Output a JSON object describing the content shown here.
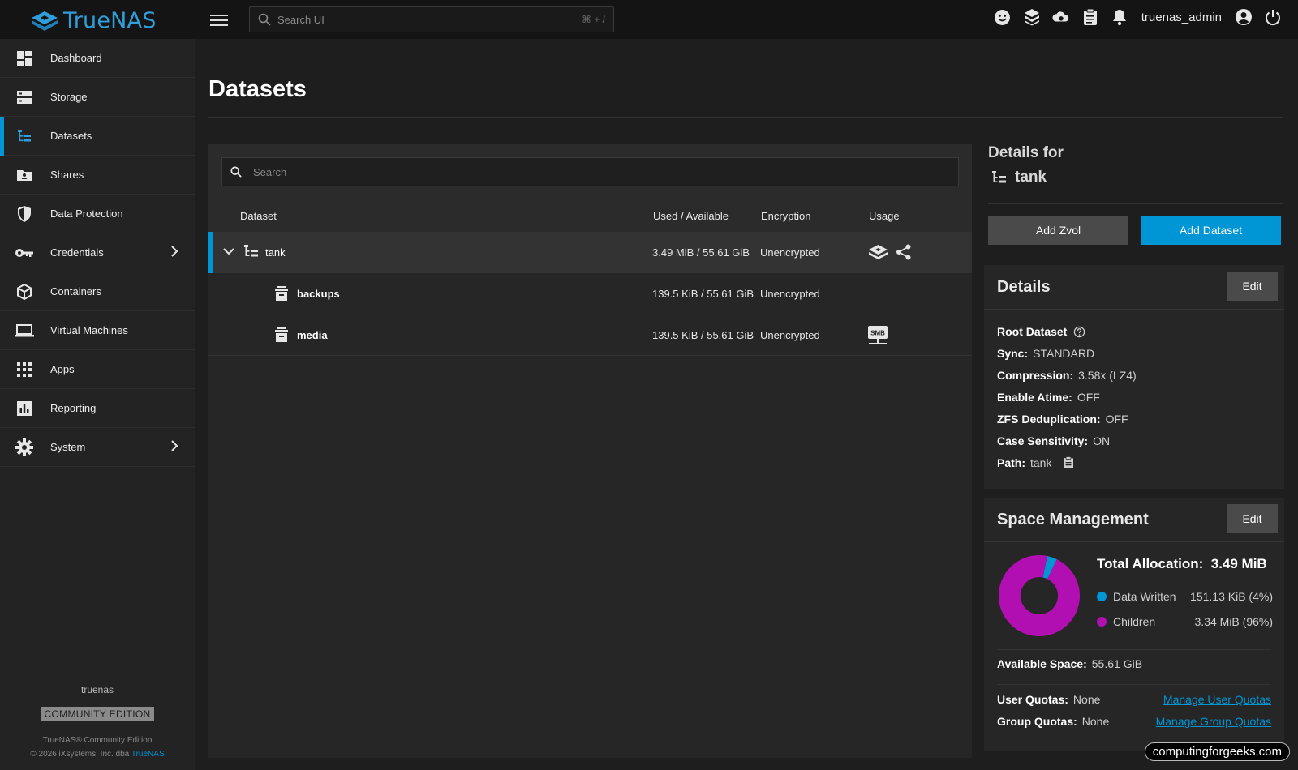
{
  "app": {
    "brand": "TrueNAS",
    "accent": "#0095d5"
  },
  "topbar": {
    "search_placeholder": "Search UI",
    "search_shortcut": "⌘ + /",
    "username": "truenas_admin",
    "icons": [
      "feedback-icon",
      "truecommand-icon",
      "jobs-icon",
      "clipboard-icon",
      "bell-icon",
      "account-icon",
      "power-icon"
    ]
  },
  "sidebar": {
    "items": [
      {
        "label": "Dashboard",
        "icon": "dashboard-icon"
      },
      {
        "label": "Storage",
        "icon": "storage-icon"
      },
      {
        "label": "Datasets",
        "icon": "datasets-icon",
        "active": true
      },
      {
        "label": "Shares",
        "icon": "shares-icon"
      },
      {
        "label": "Data Protection",
        "icon": "shield-icon"
      },
      {
        "label": "Credentials",
        "icon": "key-icon",
        "expandable": true
      },
      {
        "label": "Containers",
        "icon": "cube-icon"
      },
      {
        "label": "Virtual Machines",
        "icon": "laptop-icon"
      },
      {
        "label": "Apps",
        "icon": "apps-grid-icon"
      },
      {
        "label": "Reporting",
        "icon": "reporting-icon"
      },
      {
        "label": "System",
        "icon": "gear-icon",
        "expandable": true
      }
    ],
    "footer": {
      "hostname": "truenas",
      "edition": "COMMUNITY EDITION",
      "product_line": "TrueNAS® Community Edition",
      "copyright": "© 2026 iXsystems, Inc. dba",
      "copyright_link": "TrueNAS"
    }
  },
  "page": {
    "title": "Datasets"
  },
  "datasets": {
    "search_placeholder": "Search",
    "columns": [
      "Dataset",
      "Used / Available",
      "Encryption",
      "Usage"
    ],
    "rows": [
      {
        "name": "tank",
        "used": "3.49 MiB / 55.61 GiB",
        "encryption": "Unencrypted",
        "usage_icons": [
          "truenas-logo-icon",
          "share-icon"
        ]
      },
      {
        "name": "backups",
        "used": "139.5 KiB / 55.61 GiB",
        "encryption": "Unencrypted",
        "usage_icons": []
      },
      {
        "name": "media",
        "used": "139.5 KiB / 55.61 GiB",
        "encryption": "Unencrypted",
        "usage_icons": [
          "smb-share-icon"
        ],
        "smb_label": "SMB"
      }
    ]
  },
  "details_panel": {
    "heading": "Details for",
    "dataset": "tank",
    "add_zvol": "Add Zvol",
    "add_dataset": "Add Dataset",
    "details_card": {
      "title": "Details",
      "edit": "Edit",
      "root_label": "Root Dataset",
      "fields": [
        {
          "label": "Sync:",
          "value": "STANDARD"
        },
        {
          "label": "Compression:",
          "value": "3.58x (LZ4)"
        },
        {
          "label": "Enable Atime:",
          "value": "OFF"
        },
        {
          "label": "ZFS Deduplication:",
          "value": "OFF"
        },
        {
          "label": "Case Sensitivity:",
          "value": "ON"
        },
        {
          "label": "Path:",
          "value": "tank"
        }
      ]
    },
    "space_card": {
      "title": "Space Management",
      "edit": "Edit",
      "total_label": "Total Allocation:",
      "total_value": "3.49 MiB",
      "legend": [
        {
          "label": "Data Written",
          "value": "151.13 KiB (4%)",
          "color": "#0095d5",
          "fraction": 0.04
        },
        {
          "label": "Children",
          "value": "3.34 MiB (96%)",
          "color": "#b10fb1",
          "fraction": 0.96
        }
      ],
      "available_label": "Available Space:",
      "available_value": "55.61 GiB",
      "user_quota_label": "User Quotas:",
      "user_quota_value": "None",
      "user_quota_link": "Manage User Quotas",
      "group_quota_label": "Group Quotas:",
      "group_quota_value": "None",
      "group_quota_link": "Manage Group Quotas"
    }
  },
  "watermark": "computingforgeeks.com"
}
